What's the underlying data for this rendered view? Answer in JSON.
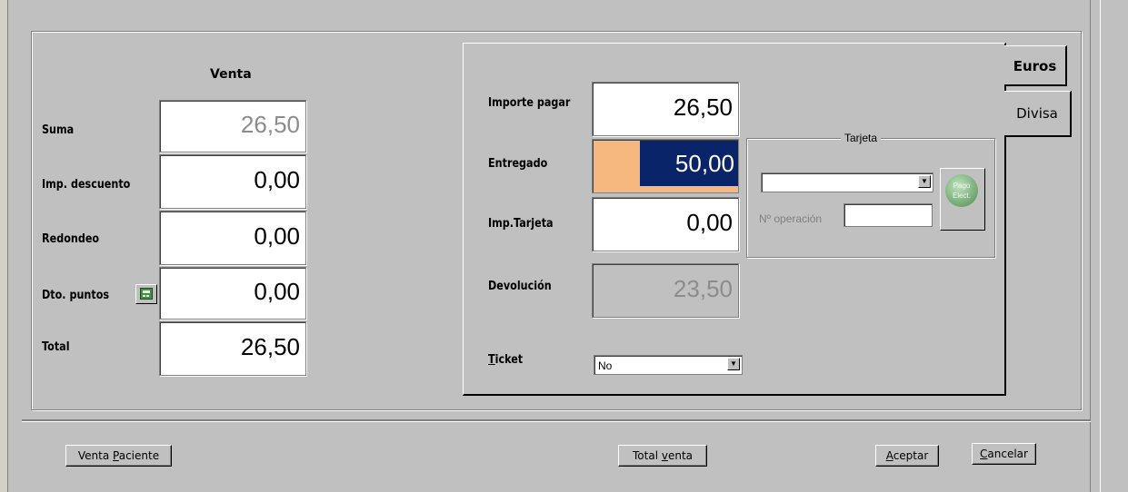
{
  "venta": {
    "heading": "Venta",
    "rows": [
      {
        "label": "Suma",
        "value": "26,50"
      },
      {
        "label": "Imp. descuento",
        "value": "0,00"
      },
      {
        "label": "Redondeo",
        "value": "0,00"
      },
      {
        "label": "Dto. puntos",
        "value": "0,00"
      },
      {
        "label": "Total",
        "value": "26,50"
      }
    ]
  },
  "payment": {
    "importe_label": "Importe pagar",
    "importe_value": "26,50",
    "entregado_label": "Entregado",
    "entregado_value": "50,00",
    "tarjeta_label": "Imp.Tarjeta",
    "tarjeta_value": "0,00",
    "devolucion_label": "Devolución",
    "devolucion_value": "23,50",
    "ticket_label": "Ticket",
    "ticket_value": "No"
  },
  "tarjeta_group": {
    "title": "Tarjeta",
    "card_select_value": "",
    "operacion_label": "Nº operación",
    "operacion_value": "",
    "pago_button_label": "Pago Elect."
  },
  "tabs": [
    {
      "label": "Euros",
      "active": true
    },
    {
      "label": "Divisa",
      "active": false
    }
  ],
  "buttons": {
    "venta_paciente": "Venta Paciente",
    "total_venta": "Total venta",
    "aceptar": "Aceptar",
    "cancelar": "Cancelar"
  },
  "colors": {
    "background": "#c0c0c0",
    "selection_bg": "#0a246a",
    "entregado_fill": "#f7b87f",
    "readonly_text": "#8c8c8c"
  }
}
